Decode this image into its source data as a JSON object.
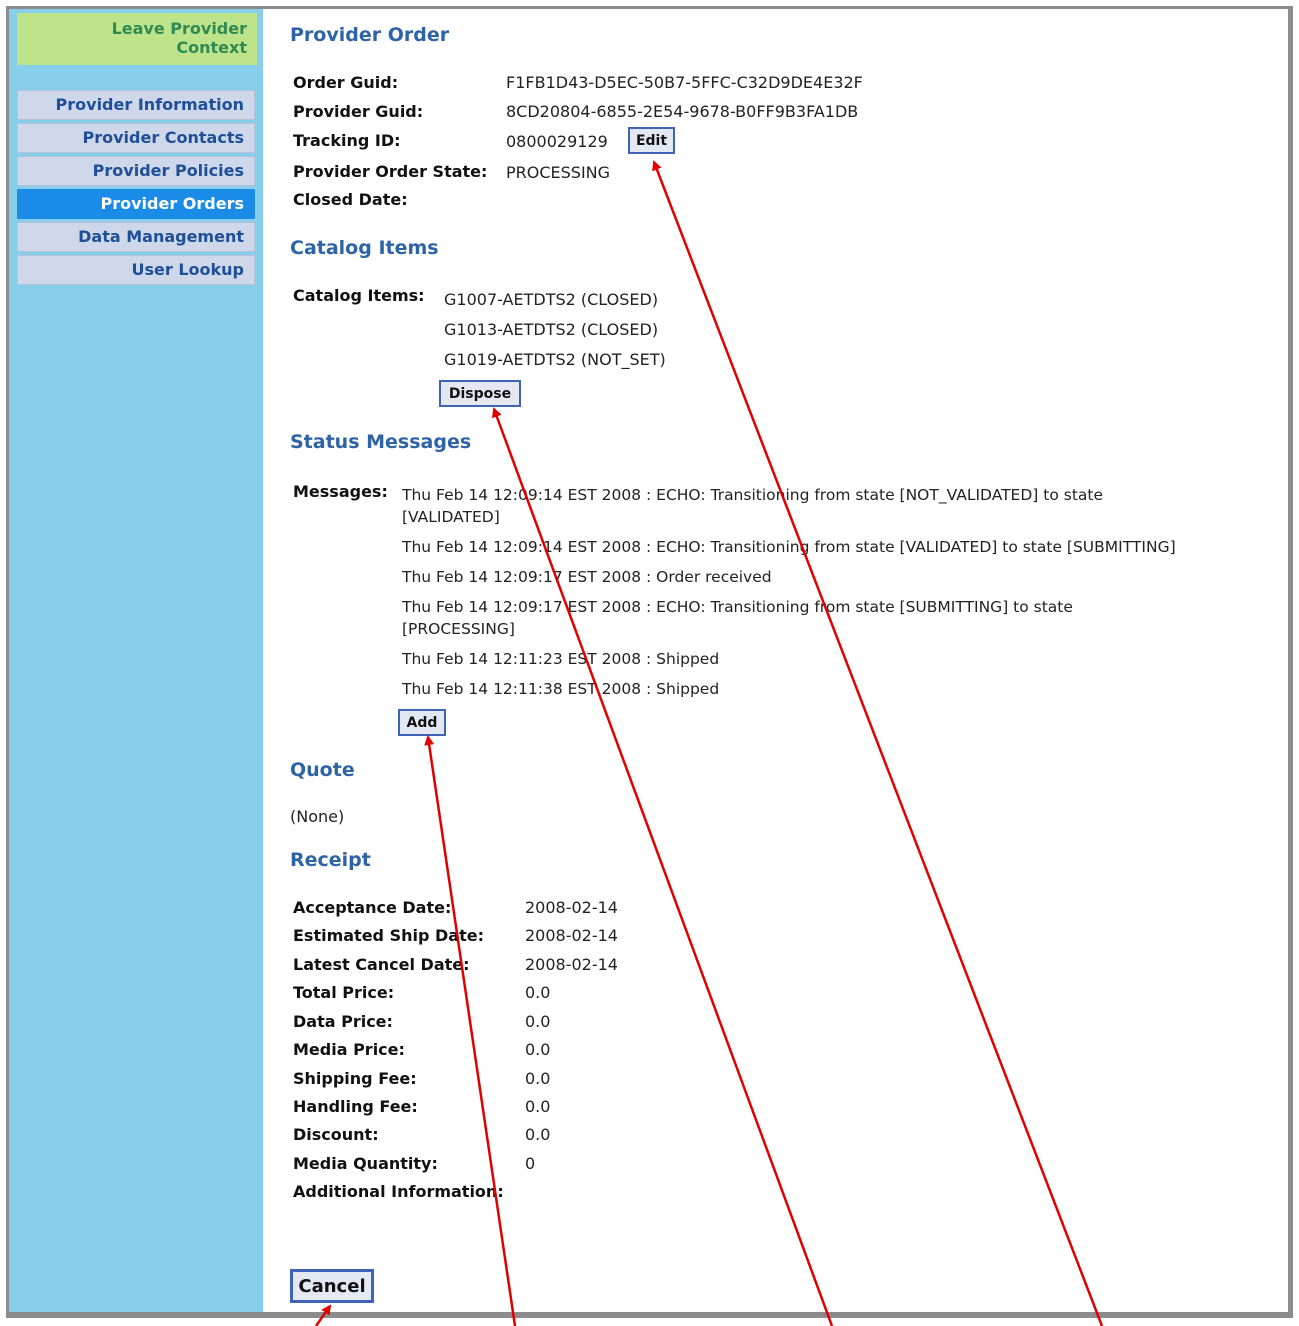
{
  "sidebar": {
    "leave_context": [
      "Leave Provider",
      "Context"
    ],
    "items": [
      {
        "label": "Provider Information",
        "active": false
      },
      {
        "label": "Provider Contacts",
        "active": false
      },
      {
        "label": "Provider Policies",
        "active": false
      },
      {
        "label": "Provider Orders",
        "active": true
      },
      {
        "label": "Data Management",
        "active": false
      },
      {
        "label": "User Lookup",
        "active": false
      }
    ]
  },
  "provider_order": {
    "heading": "Provider Order",
    "order_guid_label": "Order Guid:",
    "order_guid": "F1FB1D43-D5EC-50B7-5FFC-C32D9DE4E32F",
    "provider_guid_label": "Provider Guid:",
    "provider_guid": "8CD20804-6855-2E54-9678-B0FF9B3FA1DB",
    "tracking_id_label": "Tracking ID:",
    "tracking_id": "0800029129",
    "edit_label": "Edit",
    "state_label": "Provider Order State:",
    "state": "PROCESSING",
    "closed_date_label": "Closed Date:"
  },
  "catalog": {
    "heading": "Catalog Items",
    "label": "Catalog Items:",
    "items": [
      "G1007-AETDTS2 (CLOSED)",
      "G1013-AETDTS2 (CLOSED)",
      "G1019-AETDTS2 (NOT_SET)"
    ],
    "dispose_label": "Dispose"
  },
  "status": {
    "heading": "Status Messages",
    "label": "Messages:",
    "messages": [
      [
        "Thu Feb 14 12:09:14 EST 2008 : ECHO: Transitioning from state [NOT_VALIDATED] to state",
        "[VALIDATED]"
      ],
      [
        "Thu Feb 14 12:09:14 EST 2008 : ECHO: Transitioning from state [VALIDATED] to state [SUBMITTING]"
      ],
      [
        "Thu Feb 14 12:09:17 EST 2008 : Order received"
      ],
      [
        "Thu Feb 14 12:09:17 EST 2008 : ECHO: Transitioning from state [SUBMITTING] to state",
        "[PROCESSING]"
      ],
      [
        "Thu Feb 14 12:11:23 EST 2008 : Shipped"
      ],
      [
        "Thu Feb 14 12:11:38 EST 2008 : Shipped"
      ]
    ],
    "add_label": "Add"
  },
  "quote": {
    "heading": "Quote",
    "value": "(None)"
  },
  "receipt": {
    "heading": "Receipt",
    "rows": [
      {
        "label": "Acceptance Date:",
        "value": "2008-02-14"
      },
      {
        "label": "Estimated Ship Date:",
        "value": "2008-02-14"
      },
      {
        "label": "Latest Cancel Date:",
        "value": "2008-02-14"
      },
      {
        "label": "Total Price:",
        "value": "0.0"
      },
      {
        "label": "Data Price:",
        "value": "0.0"
      },
      {
        "label": "Media Price:",
        "value": "0.0"
      },
      {
        "label": "Shipping Fee:",
        "value": "0.0"
      },
      {
        "label": "Handling Fee:",
        "value": "0.0"
      },
      {
        "label": "Discount:",
        "value": "0.0"
      },
      {
        "label": "Media Quantity:",
        "value": "0"
      },
      {
        "label": "Additional Information:",
        "value": ""
      }
    ]
  },
  "cancel_label": "Cancel",
  "colors": {
    "sidebar_bg": "#87ceeb",
    "leave_bg": "#bde48a",
    "active_item": "#1a8be6",
    "heading": "#2e64a6",
    "annotation_arrow": "#e00000"
  },
  "annotation_arrows": [
    "edit-arrow",
    "dispose-arrow",
    "add-arrow",
    "cancel-arrow"
  ]
}
